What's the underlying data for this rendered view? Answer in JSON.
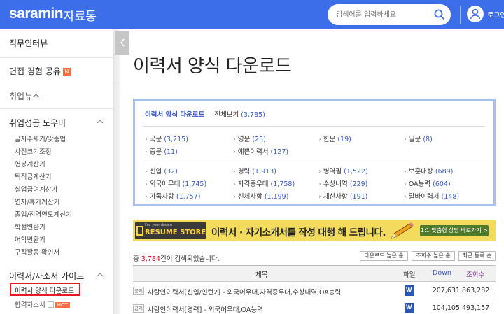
{
  "header": {
    "logo": "saramin",
    "logo_sub": "자료통",
    "search_placeholder": "검색어를 입력하세요",
    "login": "로그인"
  },
  "sidebar": {
    "items": [
      {
        "label": "직무인터뷰"
      },
      {
        "label": "면접 경험 공유",
        "badge": "N"
      },
      {
        "label": "취업뉴스"
      }
    ],
    "section1": {
      "title": "취업성공 도우미",
      "links": [
        "글자수세기/맞춤법",
        "사진크기조정",
        "연봉계산기",
        "퇴직금계산기",
        "실업급여계산기",
        "연차/휴가계산기",
        "졸업/전역연도계산기",
        "학점변환기",
        "어학변환기",
        "구직활동 확인서"
      ]
    },
    "section2": {
      "title": "이력서/자소서 가이드",
      "links": [
        "이력서 양식 다운로드",
        "합격자소서"
      ],
      "hot_badge": "HOT"
    }
  },
  "main": {
    "title": "이력서 양식 다운로드",
    "tabs": {
      "active": "이력서 양식 다운로드",
      "all": "전체보기",
      "all_count": "(3,785)"
    },
    "group1": [
      {
        "label": "국문",
        "count": "(3,215)"
      },
      {
        "label": "영문",
        "count": "(25)"
      },
      {
        "label": "한문",
        "count": "(19)"
      },
      {
        "label": "일문",
        "count": "(8)"
      },
      {
        "label": "중문",
        "count": "(11)"
      },
      {
        "label": "예쁜이력서",
        "count": "(127)"
      }
    ],
    "group2": [
      {
        "label": "신입",
        "count": "(32)"
      },
      {
        "label": "경력",
        "count": "(1,913)"
      },
      {
        "label": "병역필",
        "count": "(1,522)"
      },
      {
        "label": "보훈대상",
        "count": "(689)"
      },
      {
        "label": "외국어우대",
        "count": "(1,745)"
      },
      {
        "label": "자격증우대",
        "count": "(1,758)"
      },
      {
        "label": "수상내역",
        "count": "(229)"
      },
      {
        "label": "OA능력",
        "count": "(604)"
      },
      {
        "label": "가족사항",
        "count": "(1,757)"
      },
      {
        "label": "신체사항",
        "count": "(1,199)"
      },
      {
        "label": "재산사항",
        "count": "(191)"
      },
      {
        "label": "알바이력서",
        "count": "(148)"
      }
    ]
  },
  "banner": {
    "logo_small": "Fox your dream",
    "logo_big": "RESUME STORE",
    "text": "이력서 · 자기소개서를 작성 대행 해 드립니다.",
    "button": "1:1 맞춤형 상담 바로가기 >"
  },
  "list": {
    "result_prefix": "총 ",
    "result_count": "3,784",
    "result_suffix": "건이 검색되었습니다.",
    "sort_buttons": [
      "다운로드 높은 순",
      "조회수 높은 순",
      "최근 등록 순"
    ],
    "columns": {
      "title": "제목",
      "file": "파일",
      "down": "Down",
      "views": "조회수"
    },
    "rows": [
      {
        "notice": "공지",
        "title": "사람인이력서[신입/인턴2] - 외국어우대,자격증우대,수상내역,OA능력",
        "file_icon": "W",
        "down": "207,631",
        "views": "863,282"
      },
      {
        "notice": "공지",
        "title": "사람인이력서[경력] - 외국어우대,OA능력",
        "file_icon": "W",
        "down": "104,105",
        "views": "493,157"
      }
    ]
  },
  "colors": {
    "header_bg": "#3d6ee9",
    "link_blue": "#3b5cc7",
    "highlight_red": "#e51c23",
    "banner_bg": "#f3dc5d"
  }
}
